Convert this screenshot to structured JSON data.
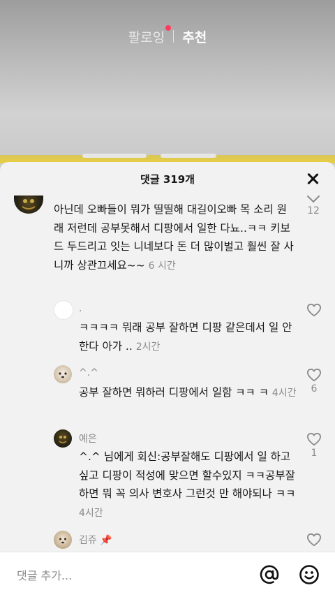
{
  "top_tabs": {
    "following": "팔로잉",
    "recommended": "추천"
  },
  "sheet": {
    "title": "댓글 319개"
  },
  "comments": [
    {
      "user": "",
      "text": "아닌데 오빠들이 뭐가 띨띨해 대길이오빠 목 소리 원래 저런데 공부못해서 디팡에서 일한 다뇨..ㅋㅋ 키보드 두드리고 잇는 니네보다 돈 더 많이벌고 훨씬 잘 사니까 상관끄세요~~",
      "time": "6 시간",
      "likes": "12",
      "icon": "chevron-down-icon"
    },
    {
      "user": ".",
      "text": "ㅋㅋㅋㅋ 뭐래 공부 잘하면 디팡 같은데서 일 안 한다 아가 ..",
      "time": "2시간",
      "likes": ""
    },
    {
      "user": "^.^",
      "text": "공부 잘하면 뭐하러 디팡에서 일함 ㅋㅋ ㅋ",
      "time": "4시간",
      "likes": "6"
    },
    {
      "user": "예은",
      "text": "^.^ 님에게 회신:공부잘해도 디팡에서 일 하고 싶고 디팡이 적성에 맞으면 할수있지 ㅋㅋ공부잘하면 뭐 꼭 의사 변호사 그런것 만 해야되나 ㅋㅋ",
      "time": "4시간",
      "likes": "1"
    },
    {
      "user": "김쥬 📌",
      "text": "",
      "time": "",
      "likes": ""
    }
  ],
  "input": {
    "placeholder": "댓글 추가..."
  },
  "colors": {
    "sheet_bg": "#f2f2f2",
    "text": "#161616",
    "muted": "#8a8a8a",
    "live_dot": "#ff3b5c"
  }
}
